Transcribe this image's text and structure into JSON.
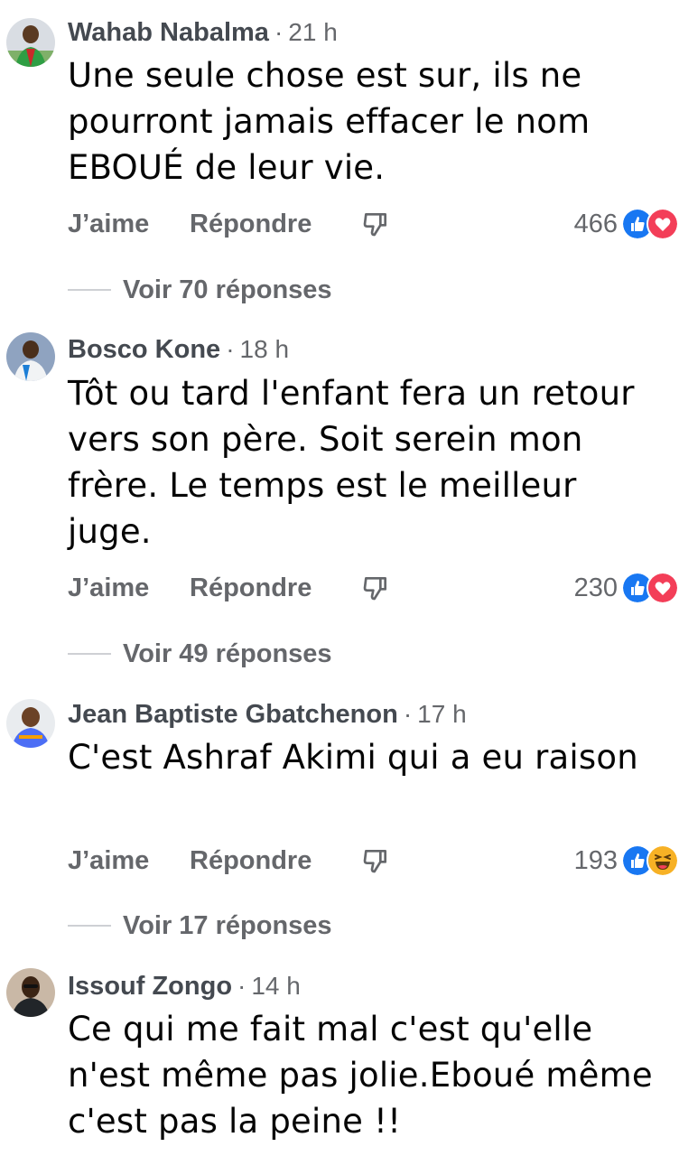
{
  "comments": [
    {
      "author": "Wahab Nabalma",
      "separator": "·",
      "time": "21 h",
      "text": "Une seule chose est sur, ils ne pourront jamais effacer le nom EBOUÉ de  leur vie.",
      "like_label": "J’aime",
      "reply_label": "Répondre",
      "reaction_count": "466",
      "reactions": [
        "like-icon",
        "love-icon"
      ],
      "view_replies": "Voir 70 réponses"
    },
    {
      "author": "Bosco Kone",
      "separator": "·",
      "time": "18 h",
      "text": "Tôt ou tard l'enfant fera un retour vers son père. Soit serein mon frère. Le temps est le meilleur juge.",
      "like_label": "J’aime",
      "reply_label": "Répondre",
      "reaction_count": "230",
      "reactions": [
        "like-icon",
        "love-icon"
      ],
      "view_replies": "Voir 49 réponses"
    },
    {
      "author": "Jean Baptiste Gbatchenon",
      "separator": "·",
      "time": "17 h",
      "text": "C'est Ashraf Akimi qui a eu raison",
      "like_label": "J’aime",
      "reply_label": "Répondre",
      "reaction_count": "193",
      "reactions": [
        "like-icon",
        "haha-icon"
      ],
      "view_replies": "Voir 17 réponses"
    },
    {
      "author": "Issouf Zongo",
      "separator": "·",
      "time": "14 h",
      "text": "Ce qui me fait mal c'est qu'elle n'est même pas jolie.Eboué même c'est pas la peine !!"
    }
  ],
  "colors": {
    "like_blue": "#1877f2",
    "love_red": "#f33e58",
    "haha_yellow": "#f7b125",
    "meta_gray": "#65676b",
    "author_gray": "#444950"
  }
}
